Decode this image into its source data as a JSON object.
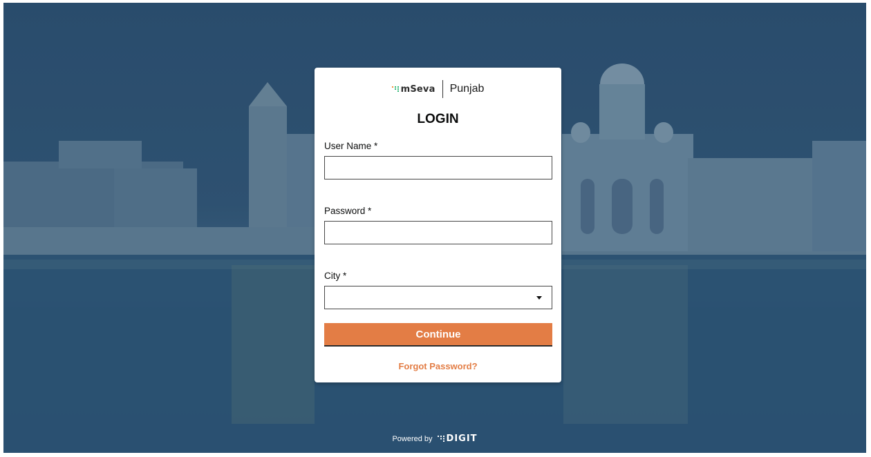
{
  "brand": {
    "product_name": "mSeva",
    "state_name": "Punjab",
    "icon": "mseva-logo-icon"
  },
  "login": {
    "title": "LOGIN",
    "username_label": "User Name *",
    "username_value": "",
    "password_label": "Password *",
    "password_value": "",
    "city_label": "City *",
    "city_value": "",
    "continue_label": "Continue",
    "forgot_password_label": "Forgot Password?"
  },
  "footer": {
    "powered_by_label": "Powered by",
    "platform_name": "DIGIT",
    "icon": "digit-logo-icon"
  },
  "colors": {
    "accent": "#e37d45",
    "overlay": "#2d4f6e",
    "card": "#ffffff",
    "text": "#0b0c0c"
  }
}
